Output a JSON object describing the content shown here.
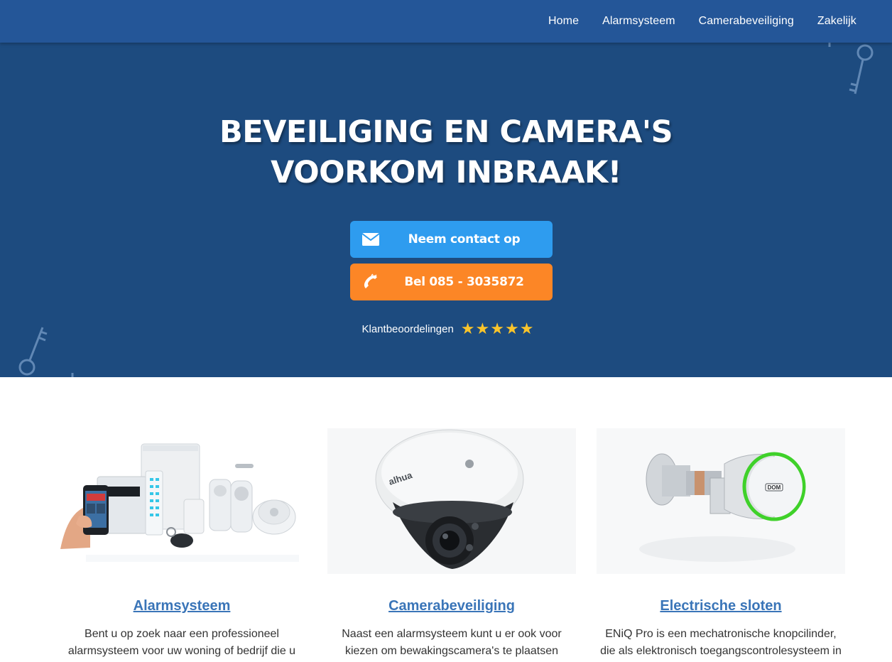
{
  "nav": {
    "items": [
      {
        "label": "Home"
      },
      {
        "label": "Alarmsysteem"
      },
      {
        "label": "Camerabeveiliging"
      },
      {
        "label": "Zakelijk"
      }
    ]
  },
  "hero": {
    "title_line1": "BEVEILIGING EN CAMERA'S",
    "title_line2": "VOORKOM INBRAAK!",
    "contact_button": "Neem contact op",
    "call_button": "Bel 085 - 3035872",
    "rating_label": "Klantbeoordelingen",
    "rating_stars": 5
  },
  "cards": [
    {
      "title": "Alarmsysteem",
      "text_line1": "Bent u op zoek naar een professioneel",
      "text_line2": "alarmsysteem voor uw woning of bedrijf die u",
      "icon": "alarm-system-image"
    },
    {
      "title": "Camerabeveiliging",
      "text_line1": "Naast een alarmsysteem kunt u er ook voor",
      "text_line2": "kiezen om bewakingscamera's te plaatsen",
      "icon": "dome-camera-image",
      "camera_brand": "alhua"
    },
    {
      "title": "Electrische sloten",
      "text_line1": "ENiQ Pro is een mechatronische knopcilinder,",
      "text_line2": "die als elektronisch toegangscontrolesysteem in",
      "icon": "electronic-lock-image",
      "lock_brand": "DOM"
    }
  ],
  "colors": {
    "navbar": "#245698",
    "hero": "#1d4b7f",
    "contact_button": "#2e9cef",
    "call_button": "#fc8626",
    "link": "#3a75b8",
    "star": "#f9c42b"
  }
}
